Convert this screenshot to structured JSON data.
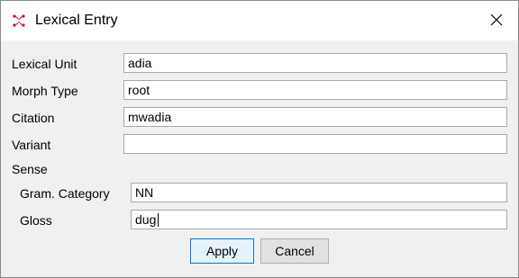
{
  "dialog": {
    "title": "Lexical Entry",
    "app_icon": "red-fern-logo-icon",
    "close_icon": "close-icon"
  },
  "form": {
    "lexical_unit": {
      "label": "Lexical Unit",
      "value": "adia"
    },
    "morph_type": {
      "label": "Morph Type",
      "value": "root"
    },
    "citation": {
      "label": "Citation",
      "value": "mwadia"
    },
    "variant": {
      "label": "Variant",
      "value": ""
    },
    "sense": {
      "label": "Sense",
      "gram_category": {
        "label": "Gram. Category",
        "value": "NN"
      },
      "gloss": {
        "label": "Gloss",
        "value": "dug"
      }
    }
  },
  "buttons": {
    "apply": "Apply",
    "cancel": "Cancel"
  },
  "colors": {
    "accent": "#0078d7",
    "icon_red": "#c8102e"
  }
}
